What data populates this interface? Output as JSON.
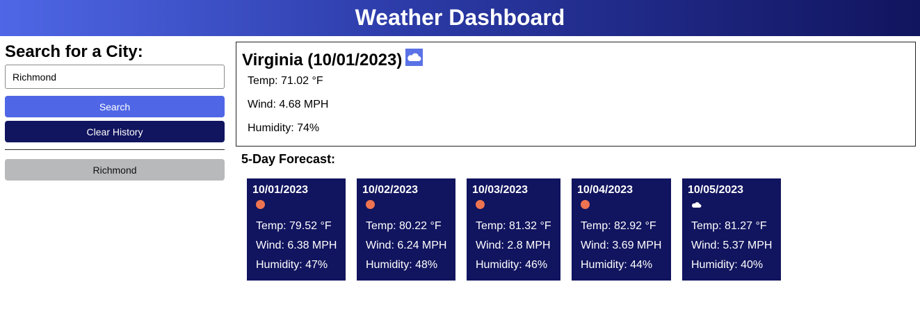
{
  "header": {
    "title": "Weather Dashboard"
  },
  "sidebar": {
    "heading": "Search for a City:",
    "input_value": "Richmond",
    "search_label": "Search",
    "clear_label": "Clear History",
    "history": [
      "Richmond"
    ]
  },
  "current": {
    "title": "Virginia (10/01/2023)",
    "icon": "cloud-icon",
    "temp": "Temp: 71.02 °F",
    "wind": "Wind: 4.68 MPH",
    "humidity": "Humidity: 74%"
  },
  "forecast": {
    "heading": "5-Day Forecast:",
    "days": [
      {
        "date": "10/01/2023",
        "icon": "sun-icon",
        "temp": "Temp: 79.52 °F",
        "wind": "Wind: 6.38 MPH",
        "humidity": "Humidity: 47%"
      },
      {
        "date": "10/02/2023",
        "icon": "sun-icon",
        "temp": "Temp: 80.22 °F",
        "wind": "Wind: 6.24 MPH",
        "humidity": "Humidity: 48%"
      },
      {
        "date": "10/03/2023",
        "icon": "sun-icon",
        "temp": "Temp: 81.32 °F",
        "wind": "Wind: 2.8 MPH",
        "humidity": "Humidity: 46%"
      },
      {
        "date": "10/04/2023",
        "icon": "sun-icon",
        "temp": "Temp: 82.92 °F",
        "wind": "Wind: 3.69 MPH",
        "humidity": "Humidity: 44%"
      },
      {
        "date": "10/05/2023",
        "icon": "cloud-icon",
        "temp": "Temp: 81.27 °F",
        "wind": "Wind: 5.37 MPH",
        "humidity": "Humidity: 40%"
      }
    ]
  },
  "colors": {
    "primary": "#4f67e6",
    "dark": "#11145e",
    "history_button": "#b8b9ba",
    "sun": "#ee7451"
  }
}
